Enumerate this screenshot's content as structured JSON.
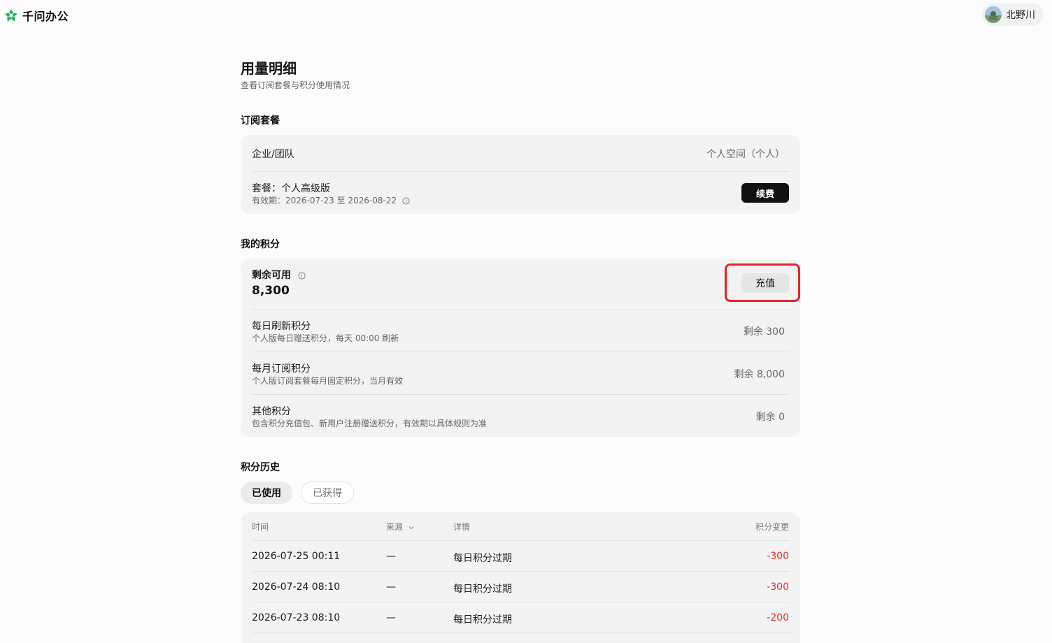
{
  "header": {
    "brand_name": "千问办公",
    "user_name": "北野川"
  },
  "page": {
    "title": "用量明细",
    "subtitle": "查看订阅套餐与积分使用情况"
  },
  "subscription": {
    "section_title": "订阅套餐",
    "org_label": "企业/团队",
    "org_value": "个人空间（个人）",
    "plan_label": "套餐：个人高级版",
    "validity": "有效期：2026-07-23 至 2026-08-22",
    "renew_label": "续费"
  },
  "points": {
    "section_title": "我的积分",
    "remaining_label": "剩余可用",
    "remaining_value": "8,300",
    "recharge_label": "充值",
    "items": [
      {
        "title": "每日刷新积分",
        "desc": "个人版每日赠送积分，每天 00:00 刷新",
        "value": "剩余 300"
      },
      {
        "title": "每月订阅积分",
        "desc": "个人版订阅套餐每月固定积分，当月有效",
        "value": "剩余 8,000"
      },
      {
        "title": "其他积分",
        "desc": "包含积分充值包、新用户注册赠送积分，有效期以具体规则为准",
        "value": "剩余 0"
      }
    ]
  },
  "history": {
    "section_title": "积分历史",
    "tabs": [
      {
        "label": "已使用",
        "active": true
      },
      {
        "label": "已获得",
        "active": false
      }
    ],
    "columns": {
      "time": "时间",
      "source": "来源",
      "detail": "详情",
      "change": "积分变更"
    },
    "rows": [
      {
        "time": "2026-07-25 00:11",
        "source": "—",
        "detail": "每日积分过期",
        "change": "-300"
      },
      {
        "time": "2026-07-24 08:10",
        "source": "—",
        "detail": "每日积分过期",
        "change": "-300"
      },
      {
        "time": "2026-07-23 08:10",
        "source": "—",
        "detail": "每日积分过期",
        "change": "-200"
      }
    ]
  },
  "colors": {
    "accent_negative": "#e02828",
    "highlight": "#e8232a",
    "brand_green": "#2fb36b"
  }
}
